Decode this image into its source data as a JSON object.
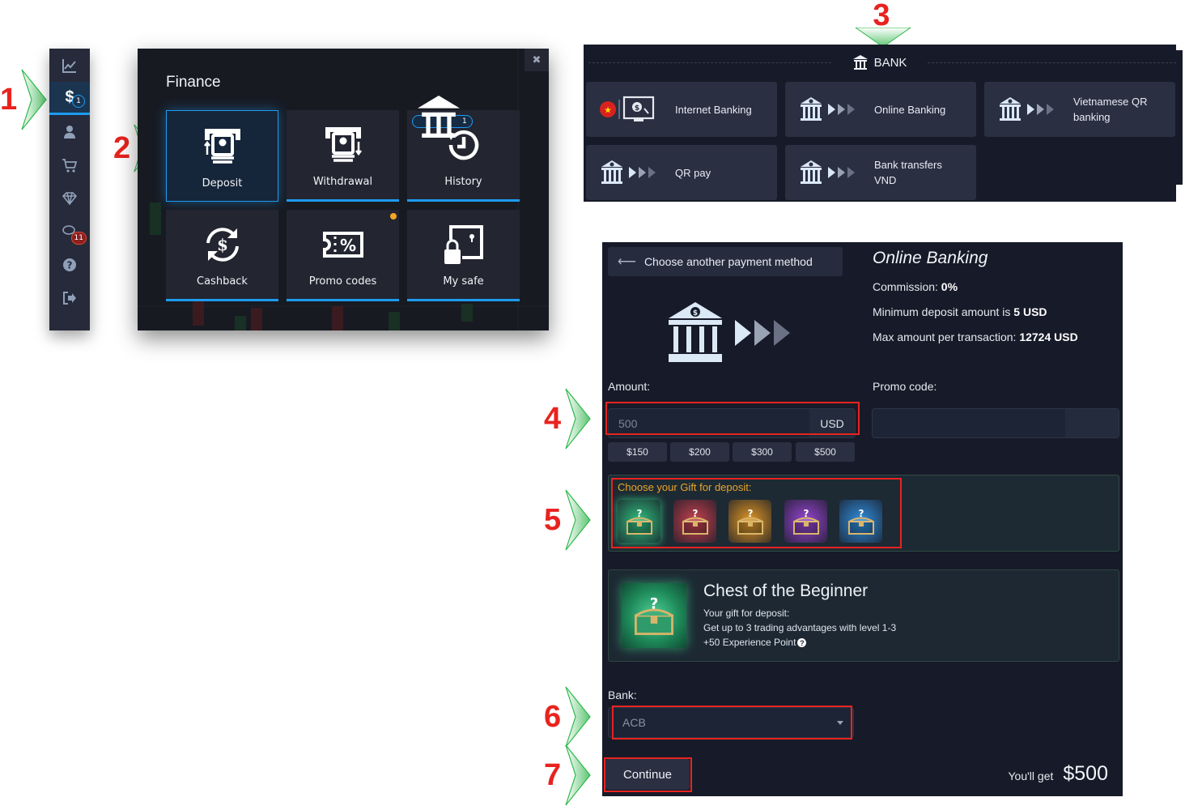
{
  "steps": [
    "1",
    "2",
    "3",
    "4",
    "5",
    "6",
    "7"
  ],
  "sidebar": {
    "items": [
      {
        "icon": "chart-icon",
        "name": "trading"
      },
      {
        "icon": "dollar-icon",
        "name": "finance",
        "badge": "1",
        "active": true
      },
      {
        "icon": "user-icon",
        "name": "profile"
      },
      {
        "icon": "cart-icon",
        "name": "market"
      },
      {
        "icon": "diamond-icon",
        "name": "achievements"
      },
      {
        "icon": "chat-icon",
        "name": "chat",
        "badge": "11"
      },
      {
        "icon": "help-icon",
        "name": "help"
      },
      {
        "icon": "logout-icon",
        "name": "logout"
      }
    ]
  },
  "finance": {
    "title": "Finance",
    "close": "✖",
    "tiles": [
      {
        "label": "Deposit",
        "icon": "deposit-icon",
        "active": true
      },
      {
        "label": "Withdrawal",
        "icon": "withdrawal-icon"
      },
      {
        "label": "History",
        "icon": "history-icon",
        "badge": "1"
      },
      {
        "label": "Cashback",
        "icon": "cashback-icon"
      },
      {
        "label": "Promo codes",
        "icon": "promo-icon",
        "dot": true
      },
      {
        "label": "My safe",
        "icon": "safe-icon"
      }
    ]
  },
  "bank": {
    "section_title": "BANK",
    "methods": [
      {
        "label": "Internet Banking",
        "icon": "internet-banking-icon"
      },
      {
        "label": "Online Banking",
        "icon": "bank-icon"
      },
      {
        "label": "Vietnamese QR banking",
        "icon": "bank-icon"
      },
      {
        "label": "QR pay",
        "icon": "bank-icon"
      },
      {
        "label": "Bank transfers VND",
        "icon": "bank-icon"
      }
    ]
  },
  "form": {
    "back_label": "Choose another payment method",
    "method_title": "Online Banking",
    "commission_label": "Commission:",
    "commission_value": "0%",
    "min_label": "Minimum deposit amount is",
    "min_value": "5 USD",
    "max_label": "Max amount per transaction:",
    "max_value": "12724 USD",
    "amount_label": "Amount:",
    "amount_value": "500",
    "currency": "USD",
    "promo_label": "Promo code:",
    "promo_value": "",
    "quick_amounts": [
      "$150",
      "$200",
      "$300",
      "$500"
    ],
    "gift_title": "Choose your Gift for deposit:",
    "gifts": [
      {
        "name": "green-chest",
        "color": "#2fbf7e",
        "selected": true
      },
      {
        "name": "red-chest",
        "color": "#c9404f"
      },
      {
        "name": "orange-chest",
        "color": "#e39a25"
      },
      {
        "name": "purple-chest",
        "color": "#9a45d6"
      },
      {
        "name": "blue-chest",
        "color": "#2f8fe0"
      }
    ],
    "chest": {
      "name": "Chest of the Beginner",
      "line1": "Your gift for deposit:",
      "line2": "Get up to 3 trading advantages with level 1-3",
      "line3": "+50 Experience Point"
    },
    "bank_label": "Bank:",
    "bank_value": "ACB",
    "continue_label": "Continue",
    "you_get_label": "You'll get",
    "you_get_value": "$500"
  }
}
